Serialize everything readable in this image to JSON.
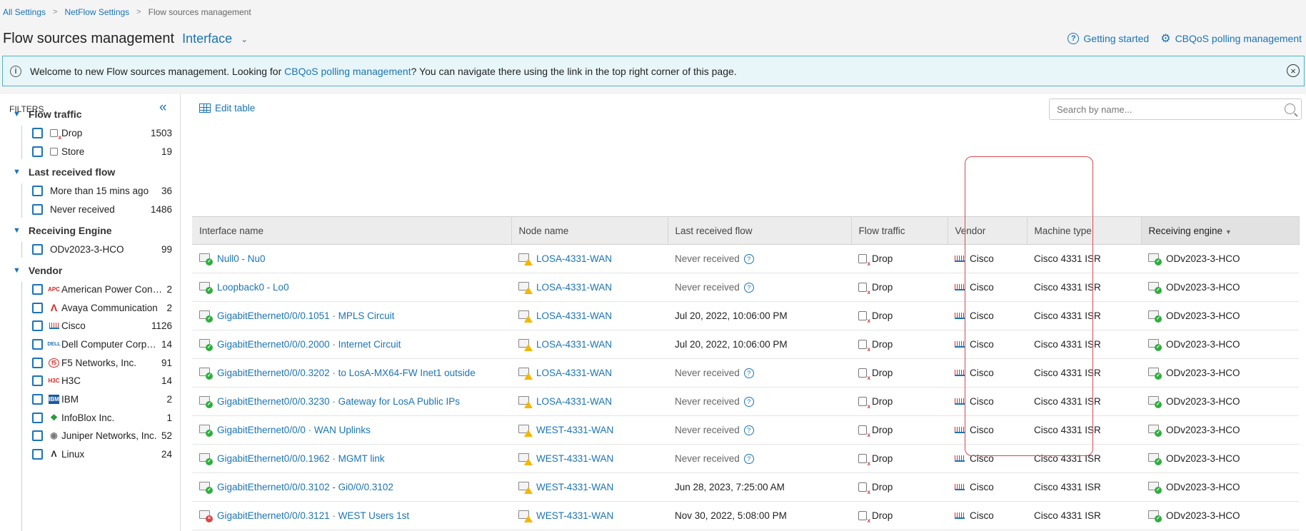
{
  "breadcrumb": [
    "All Settings",
    "NetFlow Settings",
    "Flow sources management"
  ],
  "page": {
    "title": "Flow sources management",
    "view": "Interface"
  },
  "top_links": {
    "getting_started": "Getting started",
    "cbqos": "CBQoS polling management"
  },
  "banner": {
    "bold": "Welcome to new Flow sources management.",
    "before_link": " Looking for ",
    "link": "CBQoS polling management",
    "after_link": "? You can navigate there using the link in the top right corner of this page."
  },
  "filters": {
    "title": "FILTERS",
    "groups": [
      {
        "title": "Flow traffic",
        "items": [
          {
            "label": "Drop",
            "count": "1503",
            "icon": "drop-icon"
          },
          {
            "label": "Store",
            "count": "19",
            "icon": "store-icon"
          }
        ]
      },
      {
        "title": "Last received flow",
        "items": [
          {
            "label": "More than 15 mins ago",
            "count": "36"
          },
          {
            "label": "Never received",
            "count": "1486"
          }
        ]
      },
      {
        "title": "Receiving Engine",
        "items": [
          {
            "label": "ODv2023-3-HCO",
            "count": "99"
          }
        ]
      },
      {
        "title": "Vendor",
        "items": [
          {
            "label": "American Power Conversion",
            "count": "2",
            "icon": "apc-logo-icon"
          },
          {
            "label": "Avaya Communication",
            "count": "2",
            "icon": "avaya-logo-icon"
          },
          {
            "label": "Cisco",
            "count": "1126",
            "icon": "cisco-logo-icon"
          },
          {
            "label": "Dell Computer Corporation",
            "count": "14",
            "icon": "dell-logo-icon"
          },
          {
            "label": "F5 Networks, Inc.",
            "count": "91",
            "icon": "f5-logo-icon"
          },
          {
            "label": "H3C",
            "count": "14",
            "icon": "h3c-logo-icon"
          },
          {
            "label": "IBM",
            "count": "2",
            "icon": "ibm-logo-icon"
          },
          {
            "label": "InfoBlox Inc.",
            "count": "1",
            "icon": "infoblox-logo-icon"
          },
          {
            "label": "Juniper Networks, Inc.",
            "count": "52",
            "icon": "juniper-logo-icon"
          },
          {
            "label": "Linux",
            "count": "24",
            "icon": "linux-logo-icon"
          }
        ]
      }
    ]
  },
  "toolbar": {
    "edit_table": "Edit table",
    "search_placeholder": "Search by name..."
  },
  "table": {
    "columns": [
      "Interface name",
      "Node name",
      "Last received flow",
      "Flow traffic",
      "Vendor",
      "Machine type",
      "Receiving engine"
    ],
    "sorted_column": "Receiving engine",
    "rows": [
      {
        "interface": "Null0 - Nu0",
        "status": "up",
        "node": "LOSA-4331-WAN",
        "last": "Never received",
        "never": true,
        "traffic": "Drop",
        "vendor": "Cisco",
        "machine": "Cisco 4331 ISR",
        "engine": "ODv2023-3-HCO"
      },
      {
        "interface": "Loopback0 - Lo0",
        "status": "up",
        "node": "LOSA-4331-WAN",
        "last": "Never received",
        "never": true,
        "traffic": "Drop",
        "vendor": "Cisco",
        "machine": "Cisco 4331 ISR",
        "engine": "ODv2023-3-HCO"
      },
      {
        "interface": "GigabitEthernet0/0/0.1051 · MPLS Circuit",
        "status": "up",
        "node": "LOSA-4331-WAN",
        "last": "Jul 20, 2022, 10:06:00 PM",
        "never": false,
        "traffic": "Drop",
        "vendor": "Cisco",
        "machine": "Cisco 4331 ISR",
        "engine": "ODv2023-3-HCO"
      },
      {
        "interface": "GigabitEthernet0/0/0.2000 · Internet Circuit",
        "status": "up",
        "node": "LOSA-4331-WAN",
        "last": "Jul 20, 2022, 10:06:00 PM",
        "never": false,
        "traffic": "Drop",
        "vendor": "Cisco",
        "machine": "Cisco 4331 ISR",
        "engine": "ODv2023-3-HCO"
      },
      {
        "interface": "GigabitEthernet0/0/0.3202 · to LosA-MX64-FW Inet1 outside",
        "status": "up",
        "node": "LOSA-4331-WAN",
        "last": "Never received",
        "never": true,
        "traffic": "Drop",
        "vendor": "Cisco",
        "machine": "Cisco 4331 ISR",
        "engine": "ODv2023-3-HCO"
      },
      {
        "interface": "GigabitEthernet0/0/0.3230 · Gateway for LosA Public IPs",
        "status": "up",
        "node": "LOSA-4331-WAN",
        "last": "Never received",
        "never": true,
        "traffic": "Drop",
        "vendor": "Cisco",
        "machine": "Cisco 4331 ISR",
        "engine": "ODv2023-3-HCO"
      },
      {
        "interface": "GigabitEthernet0/0/0 · WAN Uplinks",
        "status": "up",
        "node": "WEST-4331-WAN",
        "last": "Never received",
        "never": true,
        "traffic": "Drop",
        "vendor": "Cisco",
        "machine": "Cisco 4331 ISR",
        "engine": "ODv2023-3-HCO"
      },
      {
        "interface": "GigabitEthernet0/0/0.1962 · MGMT link",
        "status": "up",
        "node": "WEST-4331-WAN",
        "last": "Never received",
        "never": true,
        "traffic": "Drop",
        "vendor": "Cisco",
        "machine": "Cisco 4331 ISR",
        "engine": "ODv2023-3-HCO"
      },
      {
        "interface": "GigabitEthernet0/0/0.3102 - Gi0/0/0.3102",
        "status": "up",
        "node": "WEST-4331-WAN",
        "last": "Jun 28, 2023, 7:25:00 AM",
        "never": false,
        "traffic": "Drop",
        "vendor": "Cisco",
        "machine": "Cisco 4331 ISR",
        "engine": "ODv2023-3-HCO"
      },
      {
        "interface": "GigabitEthernet0/0/0.3121 · WEST Users 1st",
        "status": "down",
        "node": "WEST-4331-WAN",
        "last": "Nov 30, 2022, 5:08:00 PM",
        "never": false,
        "traffic": "Drop",
        "vendor": "Cisco",
        "machine": "Cisco 4331 ISR",
        "engine": "ODv2023-3-HCO"
      }
    ]
  }
}
